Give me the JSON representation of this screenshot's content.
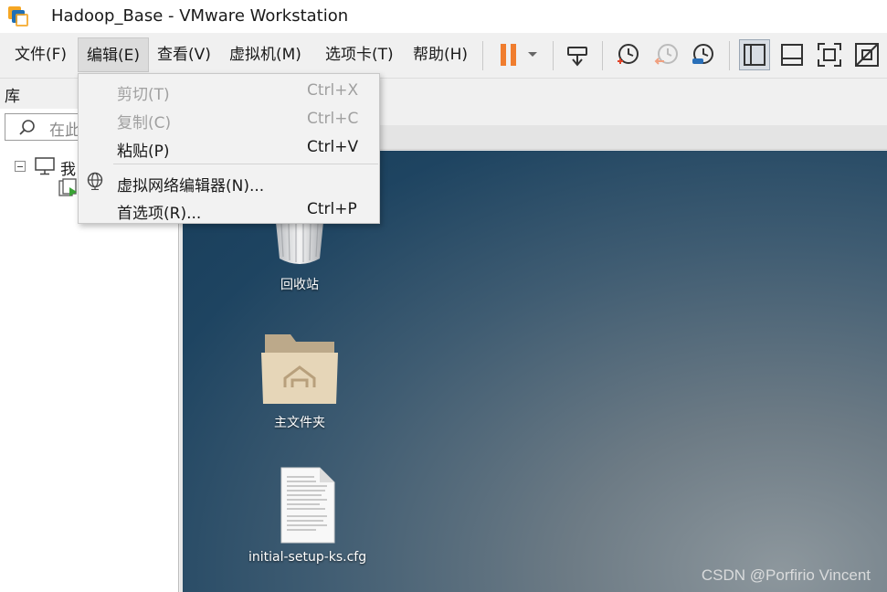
{
  "window": {
    "title": "Hadoop_Base - VMware Workstation"
  },
  "menubar": {
    "items": [
      {
        "label": "文件(F)"
      },
      {
        "label": "编辑(E)"
      },
      {
        "label": "查看(V)"
      },
      {
        "label": "虚拟机(M)"
      },
      {
        "label": "选项卡(T)"
      },
      {
        "label": "帮助(H)"
      }
    ]
  },
  "toolbar": {
    "icons": [
      "pause-icon",
      "dropdown-arrow-icon",
      "send-ctrl-alt-del-icon",
      "snapshot-icon",
      "revert-snapshot-icon",
      "snapshot-manager-icon",
      "library-view-icon",
      "thumbnail-bar-icon",
      "full-screen-icon",
      "unity-icon"
    ],
    "accent": "#f07d2e"
  },
  "library": {
    "header": "库",
    "search_placeholder": "在此",
    "tree_root_label": "我"
  },
  "edit_menu": {
    "items": [
      {
        "label": "剪切(T)",
        "shortcut": "Ctrl+X",
        "enabled": false
      },
      {
        "label": "复制(C)",
        "shortcut": "Ctrl+C",
        "enabled": false
      },
      {
        "label": "粘贴(P)",
        "shortcut": "Ctrl+V",
        "enabled": true
      },
      {
        "label": "虚拟网络编辑器(N)...",
        "shortcut": "",
        "enabled": true,
        "icon": "globe-icon"
      },
      {
        "label": "首选项(R)...",
        "shortcut": "Ctrl+P",
        "enabled": true
      }
    ]
  },
  "desktop": {
    "icons": [
      {
        "label": "回收站",
        "icon": "trash-icon"
      },
      {
        "label": "主文件夹",
        "icon": "home-folder-icon"
      },
      {
        "label": "initial-setup-ks.cfg",
        "icon": "text-file-icon"
      }
    ]
  },
  "watermark": "CSDN @Porfirio Vincent"
}
